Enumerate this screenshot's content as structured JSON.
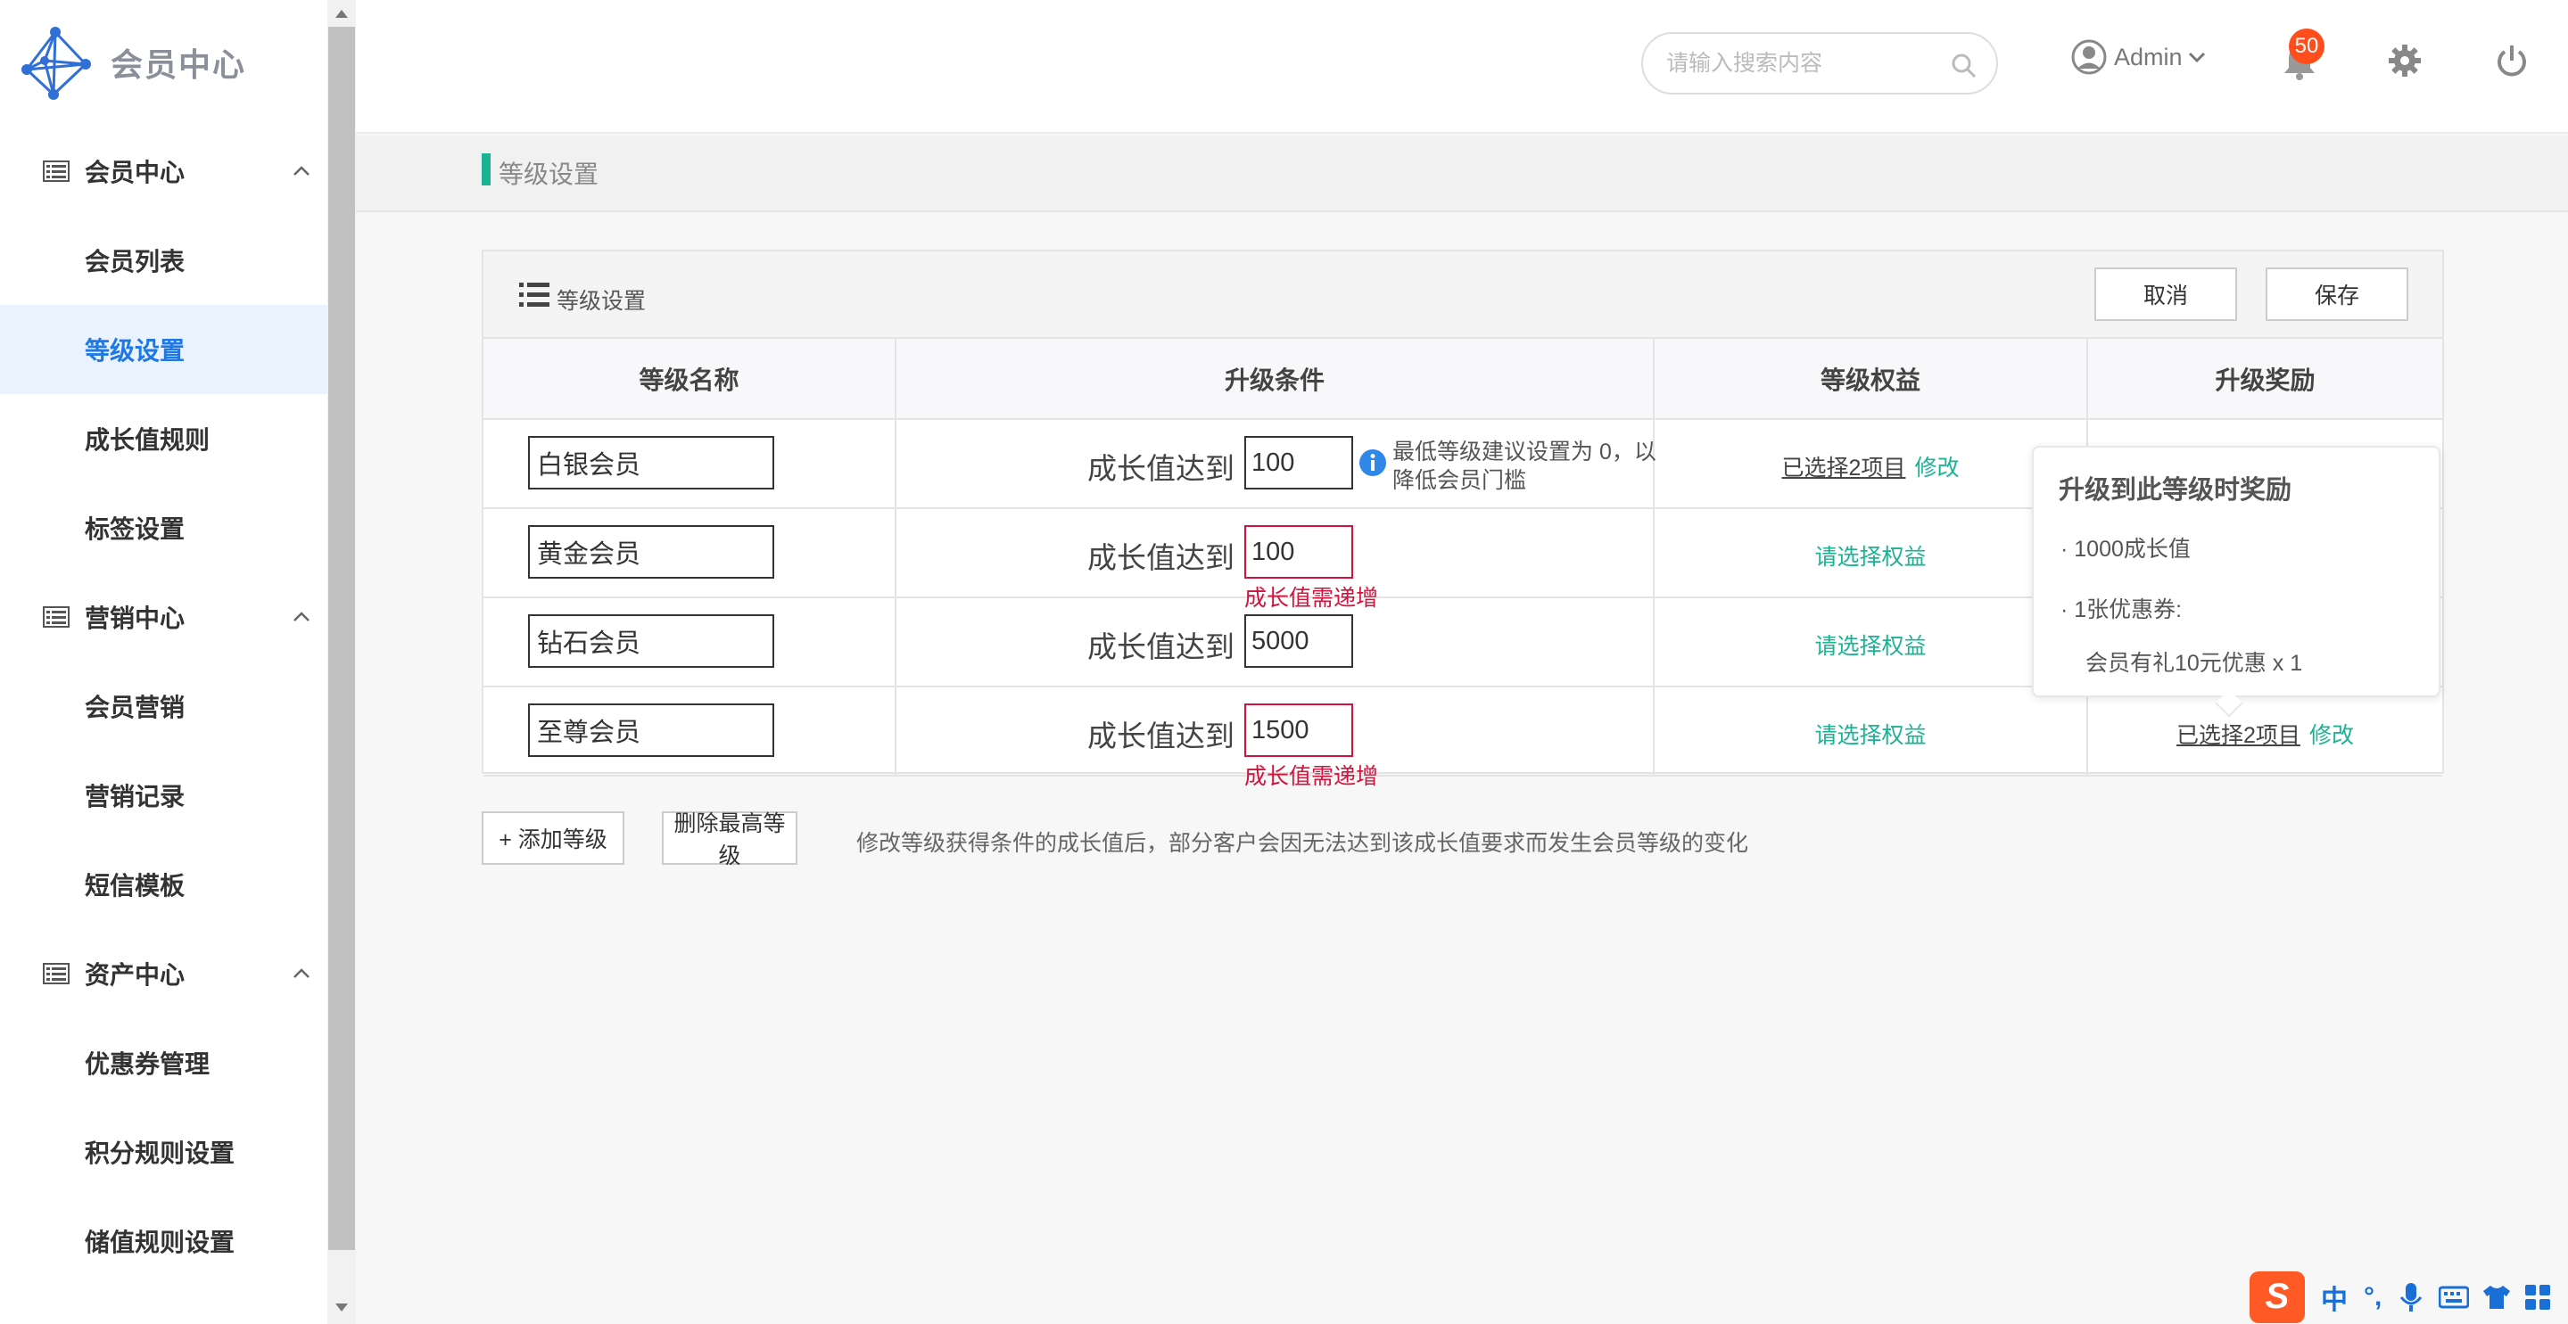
{
  "app": {
    "title": "会员中心"
  },
  "sidebar": {
    "groups": [
      {
        "label": "会员中心",
        "items": [
          "会员列表",
          "等级设置",
          "成长值规则",
          "标签设置"
        ]
      },
      {
        "label": "营销中心",
        "items": [
          "会员营销",
          "营销记录",
          "短信模板"
        ]
      },
      {
        "label": "资产中心",
        "items": [
          "优惠券管理",
          "积分规则设置",
          "储值规则设置"
        ]
      }
    ],
    "active_item": "等级设置"
  },
  "header": {
    "search_placeholder": "请输入搜索内容",
    "user": "Admin",
    "notification_count": "50"
  },
  "page": {
    "title": "等级设置"
  },
  "panel": {
    "title": "等级设置",
    "cancel_label": "取消",
    "save_label": "保存",
    "columns": [
      "等级名称",
      "升级条件",
      "等级权益",
      "升级奖励"
    ],
    "condition_prefix": "成长值达到",
    "rows": [
      {
        "name": "白银会员",
        "value": "100",
        "hint": "最低等级建议设置为 0，以降低会员门槛",
        "benefit_selected": "已选择2项目",
        "benefit_edit": "修改"
      },
      {
        "name": "黄金会员",
        "value": "100",
        "error": "成长值需递增",
        "benefit": "请选择权益"
      },
      {
        "name": "钻石会员",
        "value": "5000",
        "benefit": "请选择权益"
      },
      {
        "name": "至尊会员",
        "value": "1500",
        "error": "成长值需递增",
        "benefit": "请选择权益",
        "reward_selected": "已选择2项目",
        "reward_edit": "修改"
      }
    ]
  },
  "tooltip": {
    "title": "升级到此等级时奖励",
    "lines": [
      "· 1000成长值",
      "· 1张优惠券:",
      "会员有礼10元优惠 x 1"
    ]
  },
  "footer": {
    "add_label": "+ 添加等级",
    "delete_label": "删除最高等级",
    "note": "修改等级获得条件的成长值后，部分客户会因无法达到该成长值要求而发生会员等级的变化"
  },
  "ime": {
    "mode": "中",
    "punct": "°,",
    "logo": "S"
  },
  "colors": {
    "accent": "#1ab394",
    "active": "#1e78e6",
    "error": "#d2143c",
    "badge": "#ff4d1c"
  }
}
